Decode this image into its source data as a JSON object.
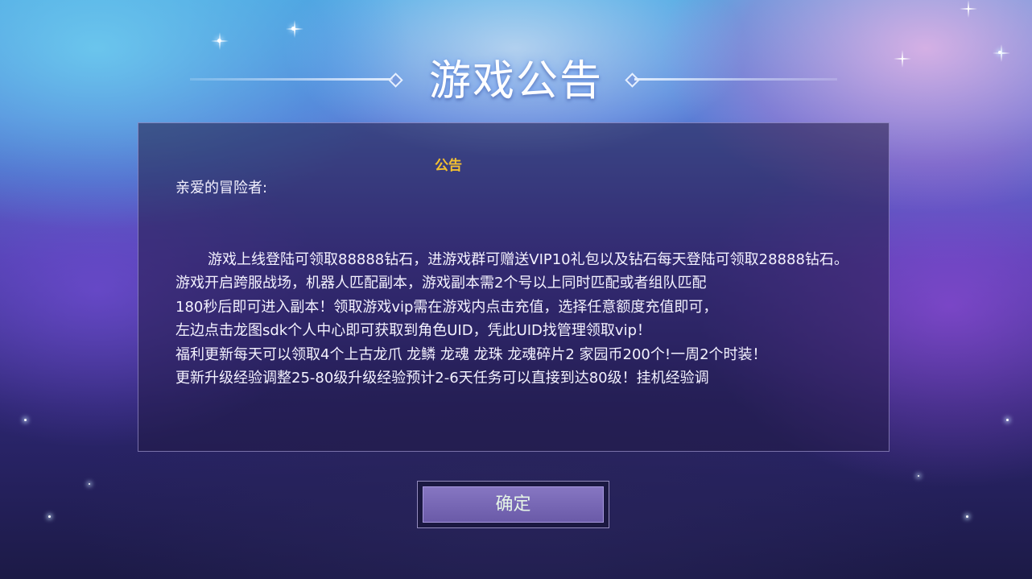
{
  "dialog": {
    "title": "游戏公告",
    "heading": "公告",
    "greeting": "亲爱的冒险者:",
    "paragraphs": [
      "游戏上线登陆可领取88888钻石，进游戏群可赠送VIP10礼包以及钻石每天登陆可领取28888钻石。游戏开启跨服战场，机器人匹配副本，游戏副本需2个号以上同时匹配或者组队匹配",
      "180秒后即可进入副本！领取游戏vip需在游戏内点击充值，选择任意额度充值即可，",
      "左边点击龙图sdk个人中心即可获取到角色UID，凭此UID找管理领取vip！",
      "福利更新每天可以领取4个上古龙爪 龙鳞 龙魂 龙珠 龙魂碎片2 家园币200个!一周2个时装！",
      "更新升级经验调整25-80级升级经验预计2-6天任务可以直接到达80级！挂机经验调"
    ],
    "confirm_label": "确定"
  },
  "colors": {
    "heading": "#f3c030",
    "button": "#7464b4",
    "text": "#f4f2ff"
  }
}
